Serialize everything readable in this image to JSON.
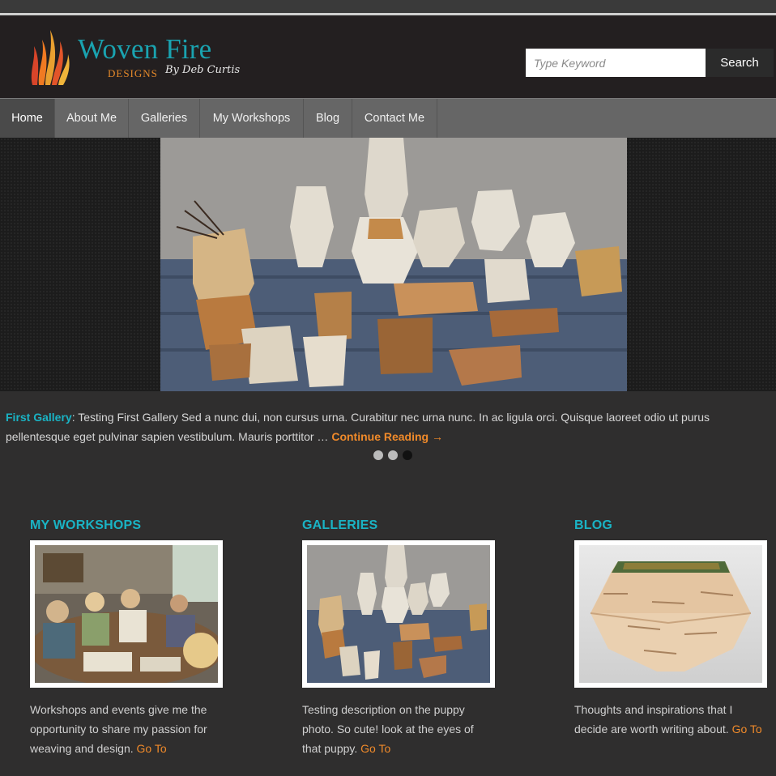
{
  "header": {
    "logo_title": "Woven Fire",
    "logo_designs": "DESIGNS",
    "logo_by": "By Deb Curtis",
    "search": {
      "placeholder": "Type Keyword",
      "button_label": "Search"
    }
  },
  "nav": {
    "items": [
      {
        "label": "Home",
        "active": true
      },
      {
        "label": "About Me"
      },
      {
        "label": "Galleries"
      },
      {
        "label": "My Workshops"
      },
      {
        "label": "Blog"
      },
      {
        "label": "Contact Me"
      }
    ]
  },
  "slider": {
    "image_alt": "woven birch bark baskets on a table",
    "caption_title": "First Gallery",
    "caption_colon": ":",
    "caption_text": " Testing First Gallery Sed a nunc dui, non cursus urna. Curabitur nec urna nunc. In ac ligula orci. Quisque laoreet odio ut purus pellentesque eget pulvinar sapien vestibulum. Mauris porttitor … ",
    "continue_label": "Continue Reading →",
    "dots": [
      false,
      false,
      true
    ]
  },
  "columns": [
    {
      "title": "MY WORKSHOPS",
      "description": "Workshops and events give me the opportunity to share my passion for weaving and design. ",
      "link_label": "Go To"
    },
    {
      "title": "GALLERIES",
      "description": "Testing description on the puppy photo. So cute! look at the eyes of that  puppy. ",
      "link_label": "Go To"
    },
    {
      "title": "BLOG",
      "description": "Thoughts and inspirations that I decide are worth writing about. ",
      "link_label": "Go To"
    }
  ],
  "colors": {
    "accent_teal": "#1ab3c4",
    "accent_orange": "#f08a2a",
    "nav_bg": "#666666",
    "header_bg": "#231f20",
    "page_bg": "#2f2e2e"
  }
}
